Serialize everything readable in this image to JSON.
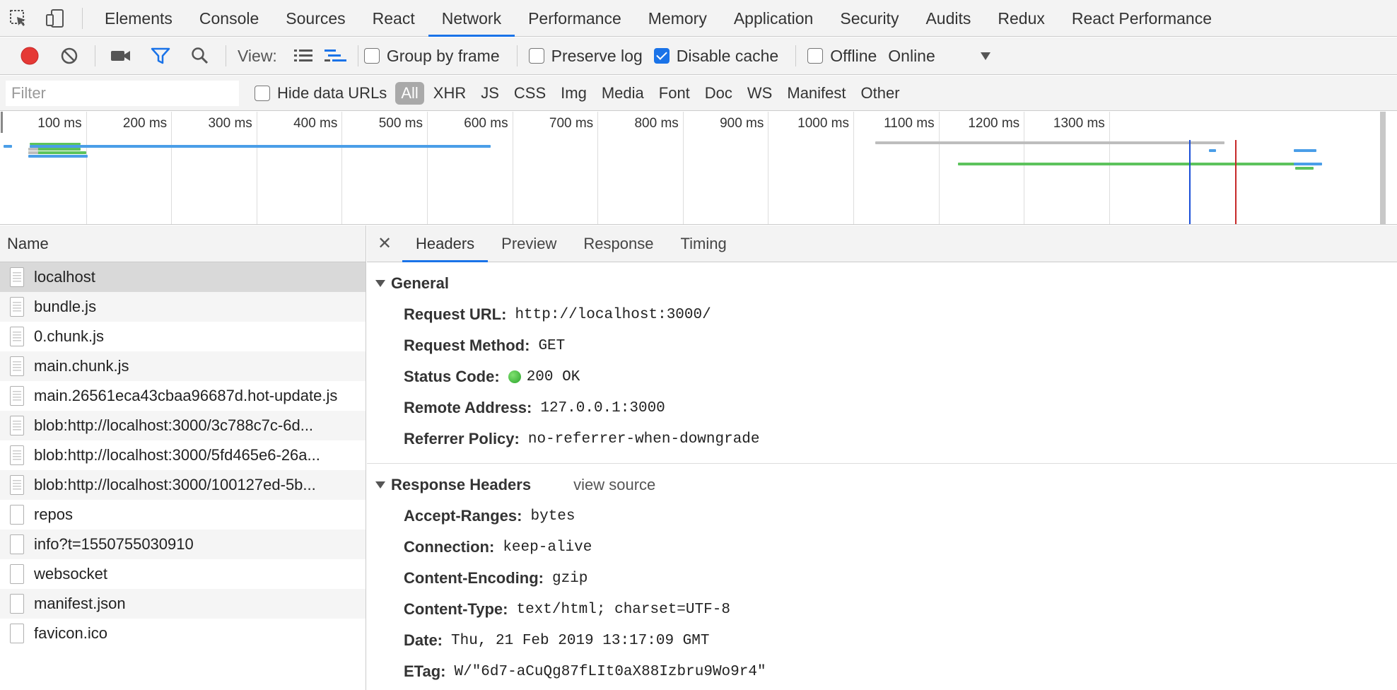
{
  "tabs": [
    "Elements",
    "Console",
    "Sources",
    "React",
    "Network",
    "Performance",
    "Memory",
    "Application",
    "Security",
    "Audits",
    "Redux",
    "React Performance"
  ],
  "active_tab": "Network",
  "toolbar": {
    "view_label": "View:",
    "group_by_frame": "Group by frame",
    "preserve_log": "Preserve log",
    "disable_cache": "Disable cache",
    "offline": "Offline",
    "throttle_value": "Online",
    "group_by_frame_checked": false,
    "preserve_log_checked": false,
    "disable_cache_checked": true,
    "offline_checked": false
  },
  "filter": {
    "placeholder": "Filter",
    "hide_data_urls": "Hide data URLs",
    "types": [
      "All",
      "XHR",
      "JS",
      "CSS",
      "Img",
      "Media",
      "Font",
      "Doc",
      "WS",
      "Manifest",
      "Other"
    ],
    "active_type": "All"
  },
  "timeline": {
    "ticks": [
      "100 ms",
      "200 ms",
      "300 ms",
      "400 ms",
      "500 ms",
      "600 ms",
      "700 ms",
      "800 ms",
      "900 ms",
      "1000 ms",
      "1100 ms",
      "1200 ms",
      "1300 ms"
    ]
  },
  "requests": {
    "header": "Name",
    "items": [
      {
        "name": "localhost",
        "icon": "document-icon",
        "selected": true
      },
      {
        "name": "bundle.js",
        "icon": "document-icon"
      },
      {
        "name": "0.chunk.js",
        "icon": "document-icon"
      },
      {
        "name": "main.chunk.js",
        "icon": "document-icon"
      },
      {
        "name": "main.26561eca43cbaa96687d.hot-update.js",
        "icon": "document-icon"
      },
      {
        "name": "blob:http://localhost:3000/3c788c7c-6d...",
        "icon": "document-icon"
      },
      {
        "name": "blob:http://localhost:3000/5fd465e6-26a...",
        "icon": "document-icon"
      },
      {
        "name": "blob:http://localhost:3000/100127ed-5b...",
        "icon": "document-icon"
      },
      {
        "name": "repos",
        "icon": "blank-file-icon"
      },
      {
        "name": "info?t=1550755030910",
        "icon": "blank-file-icon"
      },
      {
        "name": "websocket",
        "icon": "blank-file-icon"
      },
      {
        "name": "manifest.json",
        "icon": "blank-file-icon"
      },
      {
        "name": "favicon.ico",
        "icon": "blank-file-icon"
      }
    ]
  },
  "details": {
    "tabs": [
      "Headers",
      "Preview",
      "Response",
      "Timing"
    ],
    "active_tab": "Headers",
    "general": {
      "title": "General",
      "rows": [
        {
          "key": "Request URL:",
          "value": "http://localhost:3000/"
        },
        {
          "key": "Request Method:",
          "value": "GET"
        },
        {
          "key": "Status Code:",
          "value": "200 OK",
          "status_color": "#2ba52b"
        },
        {
          "key": "Remote Address:",
          "value": "127.0.0.1:3000"
        },
        {
          "key": "Referrer Policy:",
          "value": "no-referrer-when-downgrade"
        }
      ]
    },
    "response_headers": {
      "title": "Response Headers",
      "view_source": "view source",
      "rows": [
        {
          "key": "Accept-Ranges:",
          "value": "bytes"
        },
        {
          "key": "Connection:",
          "value": "keep-alive"
        },
        {
          "key": "Content-Encoding:",
          "value": "gzip"
        },
        {
          "key": "Content-Type:",
          "value": "text/html; charset=UTF-8"
        },
        {
          "key": "Date:",
          "value": "Thu, 21 Feb 2019 13:17:09 GMT"
        },
        {
          "key": "ETag:",
          "value": "W/\"6d7-aCuQg87fLIt0aX88Izbru9Wo9r4\""
        }
      ]
    }
  },
  "colors": {
    "accent": "#1a73e8",
    "record": "#e53935",
    "bar_blue": "#4a9ee8",
    "bar_green": "#5cc35c",
    "bar_gray": "#bdbdbd",
    "dom_content_loaded": "#1a4fd8",
    "load": "#c62828"
  }
}
